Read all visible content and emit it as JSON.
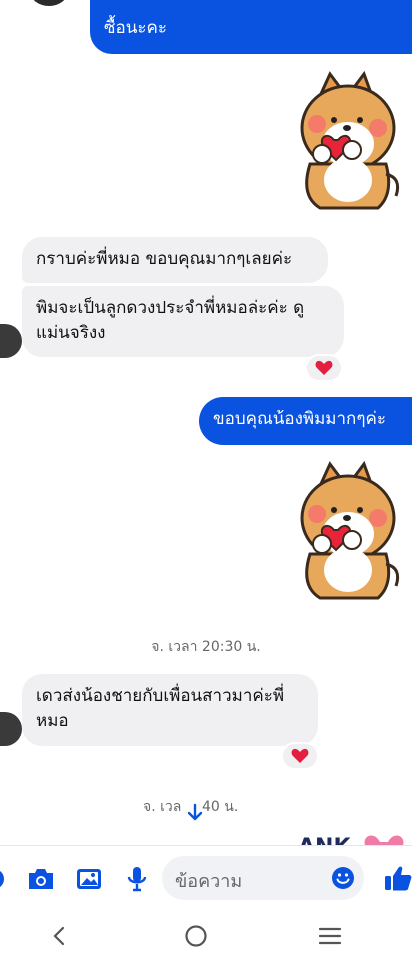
{
  "messages": [
    {
      "id": "out1",
      "text": "ซื้อนะคะ"
    },
    {
      "id": "in1",
      "text": "กราบค่ะพี่หมอ ขอบคุณมากๆเลยค่ะ"
    },
    {
      "id": "in2_line1",
      "text": "พิมจะเป็นลูกดวงประจำพี่หมอล่ะค่ะ ดู"
    },
    {
      "id": "in2_line2",
      "text": "แม่นจริงง"
    },
    {
      "id": "out2",
      "text": "ขอบคุณน้องพิมมากๆค่ะ"
    },
    {
      "id": "in3_line1",
      "text": "เดวส่งน้องชายกับเพื่อนสาวมาค่ะพี่"
    },
    {
      "id": "in3_line2",
      "text": "หมอ"
    }
  ],
  "timestamps": {
    "first": "จ. เวลา 20:30 น.",
    "second_left": "จ. เวล",
    "second_right": "40 น."
  },
  "reactions": {
    "emoji": "heart",
    "color": "#e41e3f"
  },
  "composer": {
    "placeholder": "ข้อความ"
  },
  "colors": {
    "outgoing": "#0a52e0",
    "incoming": "#f0f0f2",
    "accent": "#0a52e0"
  },
  "icons": [
    "more-icon",
    "camera-icon",
    "image-icon",
    "mic-icon",
    "emoji-icon",
    "like-icon",
    "scroll-down-icon",
    "back-icon",
    "home-icon",
    "recents-icon"
  ]
}
